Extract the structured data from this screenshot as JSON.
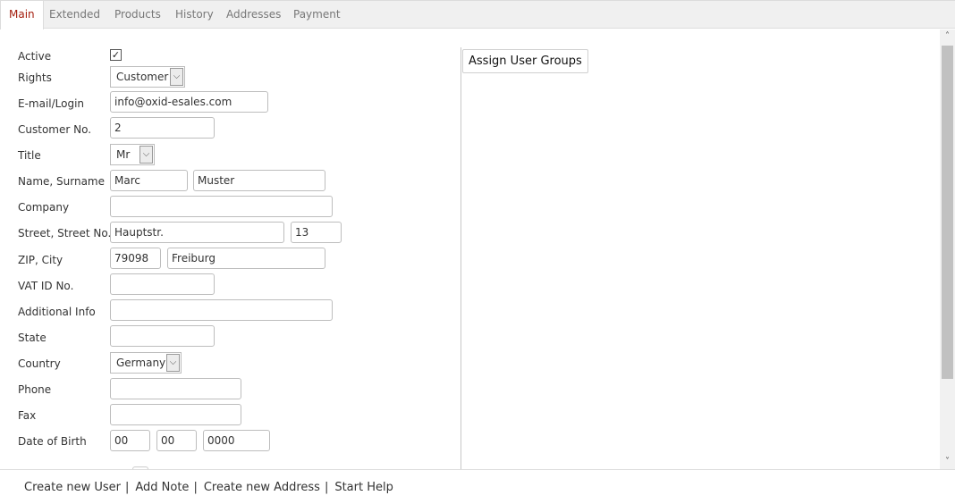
{
  "tabs": [
    {
      "label": "Main"
    },
    {
      "label": "Extended"
    },
    {
      "label": "Products"
    },
    {
      "label": "History"
    },
    {
      "label": "Addresses"
    },
    {
      "label": "Payment"
    }
  ],
  "form": {
    "active_label": "Active",
    "active_checked": true,
    "active_check_glyph": "✓",
    "rights_label": "Rights",
    "rights_value": "Customer",
    "email_label": "E-mail/Login",
    "email_value": "info@oxid-esales.com",
    "customer_no_label": "Customer No.",
    "customer_no_value": "2",
    "title_label": "Title",
    "title_value": "Mr",
    "name_label": "Name, Surname",
    "first_name_value": "Marc",
    "surname_value": "Muster",
    "company_label": "Company",
    "company_value": "",
    "street_label": "Street, Street No.",
    "street_value": "Hauptstr.",
    "street_no_value": "13",
    "zip_city_label": "ZIP, City",
    "zip_value": "79098",
    "city_value": "Freiburg",
    "vat_label": "VAT ID No.",
    "vat_value": "",
    "additional_label": "Additional Info",
    "additional_value": "",
    "state_label": "State",
    "state_value": "",
    "country_label": "Country",
    "country_value": "Germany",
    "phone_label": "Phone",
    "phone_value": "",
    "fax_label": "Fax",
    "fax_value": "",
    "dob_label": "Date of Birth",
    "dob_day_value": "00",
    "dob_month_value": "00",
    "dob_year_value": "0000"
  },
  "right_panel": {
    "assign_groups_label": "Assign User Groups"
  },
  "icons": {
    "dropdown_arrow": "chevron-down-icon",
    "scroll_up": "scroll-up-arrow-icon",
    "scroll_down": "scroll-down-arrow-icon"
  },
  "footer": {
    "links": [
      {
        "label": "Create new User"
      },
      {
        "label": "Add Note"
      },
      {
        "label": "Create new Address"
      },
      {
        "label": "Start Help"
      }
    ],
    "separator": "|"
  },
  "colors": {
    "active_tab_text": "#a41e0e",
    "tab_text": "#777777",
    "tab_bar_bg": "#f0f0f0"
  }
}
